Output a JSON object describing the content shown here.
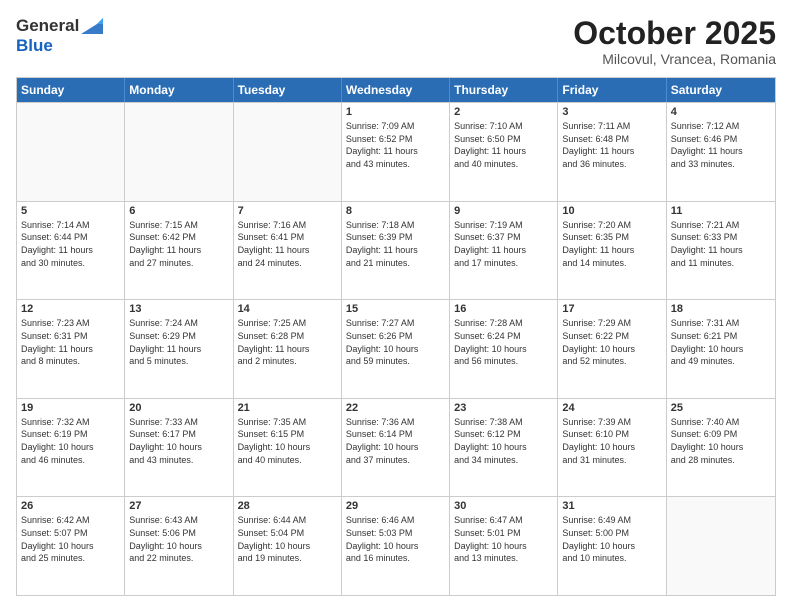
{
  "header": {
    "logo_general": "General",
    "logo_blue": "Blue",
    "month_title": "October 2025",
    "location": "Milcovul, Vrancea, Romania"
  },
  "weekdays": [
    "Sunday",
    "Monday",
    "Tuesday",
    "Wednesday",
    "Thursday",
    "Friday",
    "Saturday"
  ],
  "rows": [
    [
      {
        "date": "",
        "info": ""
      },
      {
        "date": "",
        "info": ""
      },
      {
        "date": "",
        "info": ""
      },
      {
        "date": "1",
        "info": "Sunrise: 7:09 AM\nSunset: 6:52 PM\nDaylight: 11 hours\nand 43 minutes."
      },
      {
        "date": "2",
        "info": "Sunrise: 7:10 AM\nSunset: 6:50 PM\nDaylight: 11 hours\nand 40 minutes."
      },
      {
        "date": "3",
        "info": "Sunrise: 7:11 AM\nSunset: 6:48 PM\nDaylight: 11 hours\nand 36 minutes."
      },
      {
        "date": "4",
        "info": "Sunrise: 7:12 AM\nSunset: 6:46 PM\nDaylight: 11 hours\nand 33 minutes."
      }
    ],
    [
      {
        "date": "5",
        "info": "Sunrise: 7:14 AM\nSunset: 6:44 PM\nDaylight: 11 hours\nand 30 minutes."
      },
      {
        "date": "6",
        "info": "Sunrise: 7:15 AM\nSunset: 6:42 PM\nDaylight: 11 hours\nand 27 minutes."
      },
      {
        "date": "7",
        "info": "Sunrise: 7:16 AM\nSunset: 6:41 PM\nDaylight: 11 hours\nand 24 minutes."
      },
      {
        "date": "8",
        "info": "Sunrise: 7:18 AM\nSunset: 6:39 PM\nDaylight: 11 hours\nand 21 minutes."
      },
      {
        "date": "9",
        "info": "Sunrise: 7:19 AM\nSunset: 6:37 PM\nDaylight: 11 hours\nand 17 minutes."
      },
      {
        "date": "10",
        "info": "Sunrise: 7:20 AM\nSunset: 6:35 PM\nDaylight: 11 hours\nand 14 minutes."
      },
      {
        "date": "11",
        "info": "Sunrise: 7:21 AM\nSunset: 6:33 PM\nDaylight: 11 hours\nand 11 minutes."
      }
    ],
    [
      {
        "date": "12",
        "info": "Sunrise: 7:23 AM\nSunset: 6:31 PM\nDaylight: 11 hours\nand 8 minutes."
      },
      {
        "date": "13",
        "info": "Sunrise: 7:24 AM\nSunset: 6:29 PM\nDaylight: 11 hours\nand 5 minutes."
      },
      {
        "date": "14",
        "info": "Sunrise: 7:25 AM\nSunset: 6:28 PM\nDaylight: 11 hours\nand 2 minutes."
      },
      {
        "date": "15",
        "info": "Sunrise: 7:27 AM\nSunset: 6:26 PM\nDaylight: 10 hours\nand 59 minutes."
      },
      {
        "date": "16",
        "info": "Sunrise: 7:28 AM\nSunset: 6:24 PM\nDaylight: 10 hours\nand 56 minutes."
      },
      {
        "date": "17",
        "info": "Sunrise: 7:29 AM\nSunset: 6:22 PM\nDaylight: 10 hours\nand 52 minutes."
      },
      {
        "date": "18",
        "info": "Sunrise: 7:31 AM\nSunset: 6:21 PM\nDaylight: 10 hours\nand 49 minutes."
      }
    ],
    [
      {
        "date": "19",
        "info": "Sunrise: 7:32 AM\nSunset: 6:19 PM\nDaylight: 10 hours\nand 46 minutes."
      },
      {
        "date": "20",
        "info": "Sunrise: 7:33 AM\nSunset: 6:17 PM\nDaylight: 10 hours\nand 43 minutes."
      },
      {
        "date": "21",
        "info": "Sunrise: 7:35 AM\nSunset: 6:15 PM\nDaylight: 10 hours\nand 40 minutes."
      },
      {
        "date": "22",
        "info": "Sunrise: 7:36 AM\nSunset: 6:14 PM\nDaylight: 10 hours\nand 37 minutes."
      },
      {
        "date": "23",
        "info": "Sunrise: 7:38 AM\nSunset: 6:12 PM\nDaylight: 10 hours\nand 34 minutes."
      },
      {
        "date": "24",
        "info": "Sunrise: 7:39 AM\nSunset: 6:10 PM\nDaylight: 10 hours\nand 31 minutes."
      },
      {
        "date": "25",
        "info": "Sunrise: 7:40 AM\nSunset: 6:09 PM\nDaylight: 10 hours\nand 28 minutes."
      }
    ],
    [
      {
        "date": "26",
        "info": "Sunrise: 6:42 AM\nSunset: 5:07 PM\nDaylight: 10 hours\nand 25 minutes."
      },
      {
        "date": "27",
        "info": "Sunrise: 6:43 AM\nSunset: 5:06 PM\nDaylight: 10 hours\nand 22 minutes."
      },
      {
        "date": "28",
        "info": "Sunrise: 6:44 AM\nSunset: 5:04 PM\nDaylight: 10 hours\nand 19 minutes."
      },
      {
        "date": "29",
        "info": "Sunrise: 6:46 AM\nSunset: 5:03 PM\nDaylight: 10 hours\nand 16 minutes."
      },
      {
        "date": "30",
        "info": "Sunrise: 6:47 AM\nSunset: 5:01 PM\nDaylight: 10 hours\nand 13 minutes."
      },
      {
        "date": "31",
        "info": "Sunrise: 6:49 AM\nSunset: 5:00 PM\nDaylight: 10 hours\nand 10 minutes."
      },
      {
        "date": "",
        "info": ""
      }
    ]
  ]
}
